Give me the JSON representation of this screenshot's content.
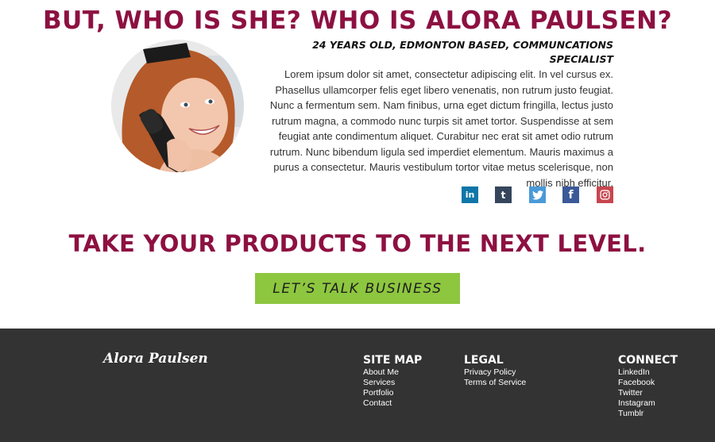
{
  "about": {
    "headline": "BUT, WHO IS SHE? WHO IS ALORA PAULSEN?",
    "subtitle": "24 YEARS OLD, EDMONTON BASED, COMMUNCATIONS SPECIALIST",
    "bio": "Lorem ipsum dolor sit amet, consectetur adipiscing elit. In vel cursus ex. Phasellus ullamcorper felis eget libero venenatis, non rutrum justo feugiat. Nunc a fermentum sem. Nam finibus, urna eget dictum fringilla, lectus justo rutrum magna, a commodo nunc turpis sit amet tortor. Suspendisse at sem feugiat ante condimentum aliquet. Curabitur nec erat sit amet odio rutrum rutrum. Nunc bibendum ligula sed imperdiet elementum. Mauris maximus a purus a consectetur. Mauris vestibulum tortor vitae metus scelerisque, non mollis nibh efficitur."
  },
  "socials": [
    {
      "icon": "linkedin-icon",
      "glyph": "in",
      "color": "#0e76a8"
    },
    {
      "icon": "tumblr-icon",
      "glyph": "t",
      "color": "#35465c"
    },
    {
      "icon": "twitter-icon",
      "glyph": "",
      "color": "#4a9ad8"
    },
    {
      "icon": "facebook-icon",
      "glyph": "f",
      "color": "#3b5998"
    },
    {
      "icon": "instagram-icon",
      "glyph": "",
      "color": "#c8464f"
    }
  ],
  "cta": {
    "title": "TAKE YOUR PRODUCTS TO THE NEXT LEVEL.",
    "button_label": "LET’S TALK BUSINESS"
  },
  "footer": {
    "logo": "Alora Paulsen",
    "sitemap": {
      "title": "SITE MAP",
      "links": [
        "About Me",
        "Services",
        "Portfolio",
        "Contact"
      ]
    },
    "legal": {
      "title": "LEGAL",
      "links": [
        "Privacy Policy",
        "Terms of Service"
      ]
    },
    "connect": {
      "title": "CONNECT",
      "links": [
        "LinkedIn",
        "Facebook",
        "Twitter",
        "Instagram",
        "Tumblr"
      ]
    }
  },
  "colors": {
    "accent": "#8d1041",
    "cta_green": "#8dc63f",
    "footer_bg": "#333333"
  }
}
